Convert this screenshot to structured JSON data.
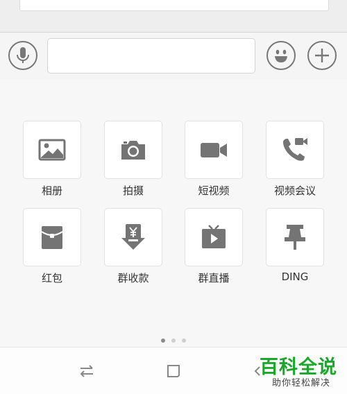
{
  "composer": {
    "message_value": ""
  },
  "features": [
    {
      "label": "相册",
      "icon": "image-icon"
    },
    {
      "label": "拍摄",
      "icon": "camera-icon"
    },
    {
      "label": "短视频",
      "icon": "video-icon"
    },
    {
      "label": "视频会议",
      "icon": "video-call-icon"
    },
    {
      "label": "红包",
      "icon": "red-envelope-icon"
    },
    {
      "label": "群收款",
      "icon": "yuan-collect-icon"
    },
    {
      "label": "群直播",
      "icon": "tv-live-icon"
    },
    {
      "label": "DING",
      "icon": "pin-icon"
    }
  ],
  "pager": {
    "pages": 3,
    "current": 1
  },
  "watermark": {
    "title": "百科全说",
    "subtitle": "助你轻松解决"
  },
  "colors": {
    "icon": "#747474",
    "watermark": "#1aa82b",
    "background": "#f7f7f7"
  }
}
